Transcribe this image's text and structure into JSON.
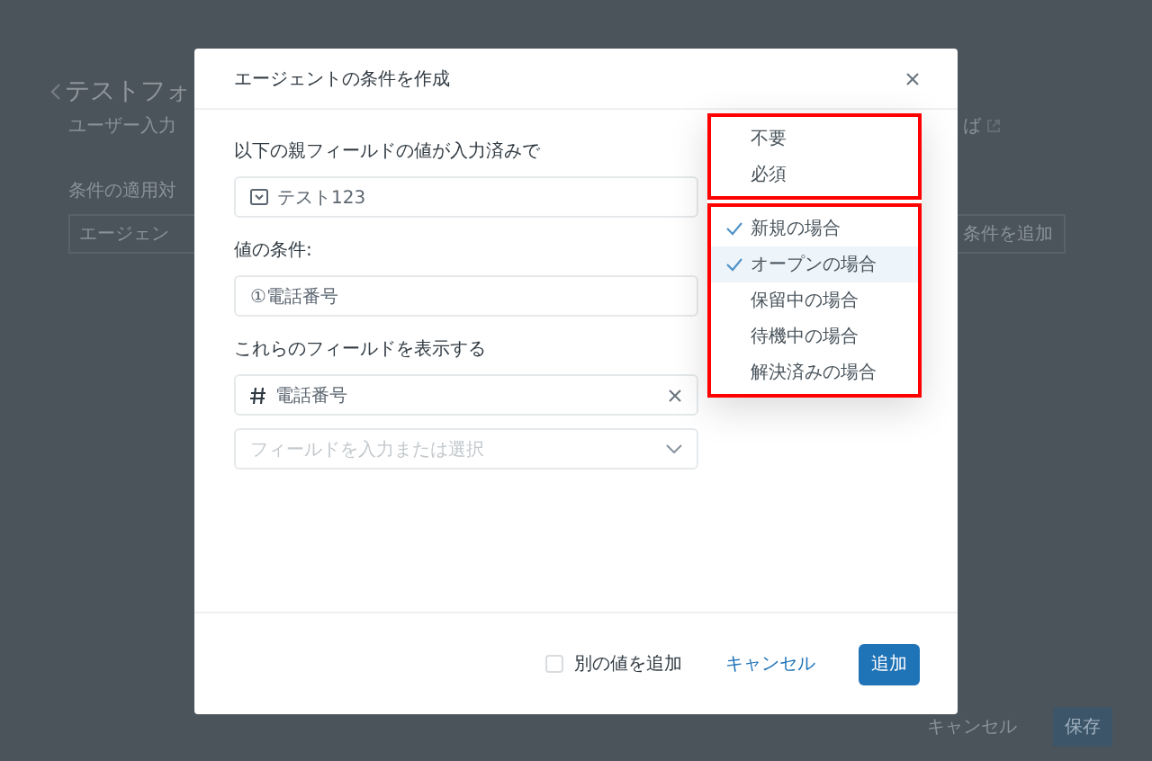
{
  "background_page": {
    "title": "テストフォ",
    "subtitle": "ユーザー入力",
    "note": "ば",
    "section_label": "条件の適用対",
    "target_field": "エージェン",
    "add_condition_button": "条件を追加",
    "cancel_button": "キャンセル",
    "save_button": "保存"
  },
  "dialog": {
    "title": "エージェントの条件を作成",
    "sections": [
      {
        "label": "以下の親フィールドの値が入力済みで",
        "fields": [
          {
            "kind": "parent",
            "value": "テスト123"
          }
        ]
      },
      {
        "label": "値の条件:",
        "fields": [
          {
            "kind": "value",
            "value": "①電話番号"
          }
        ]
      },
      {
        "label": "これらのフィールドを表示する",
        "fields": [
          {
            "kind": "chosen",
            "value": "電話番号"
          },
          {
            "kind": "picker",
            "placeholder": "フィールドを入力または選択"
          }
        ]
      }
    ],
    "footer": {
      "add_another": {
        "label": "別の値を追加",
        "checked": false
      },
      "cancel": "キャンセル",
      "submit": "追加"
    }
  },
  "dropdown": {
    "groups": [
      {
        "items": [
          {
            "label": "不要",
            "checked": false,
            "highlighted": false
          },
          {
            "label": "必須",
            "checked": false,
            "highlighted": false
          }
        ]
      },
      {
        "items": [
          {
            "label": "新規の場合",
            "checked": true,
            "highlighted": false
          },
          {
            "label": "オープンの場合",
            "checked": true,
            "highlighted": true
          },
          {
            "label": "保留中の場合",
            "checked": false,
            "highlighted": false
          },
          {
            "label": "待機中の場合",
            "checked": false,
            "highlighted": false
          },
          {
            "label": "解決済みの場合",
            "checked": false,
            "highlighted": false
          }
        ]
      }
    ]
  }
}
